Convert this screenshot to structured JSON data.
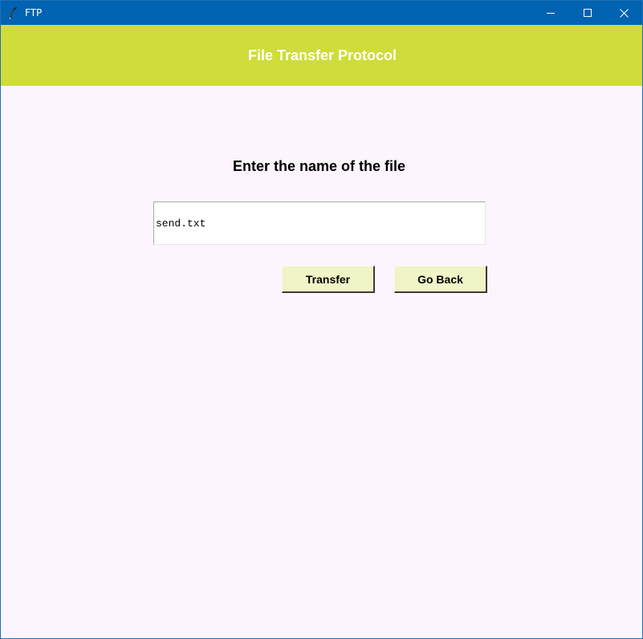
{
  "window": {
    "title": "FTP",
    "icon": "feather-icon",
    "controls": [
      "minimize-icon",
      "maximize-icon",
      "close-icon"
    ]
  },
  "header": {
    "title": "File Transfer Protocol",
    "background_color": "#cfdc39",
    "text_color": "#ffffff"
  },
  "main": {
    "prompt": "Enter the name of the file",
    "filename_value": "send.txt",
    "background_color": "#fdf5fd",
    "buttons": {
      "transfer_label": "Transfer",
      "go_back_label": "Go Back",
      "color": "#f0f4c6"
    }
  },
  "colors": {
    "titlebar": "#0063b1"
  }
}
